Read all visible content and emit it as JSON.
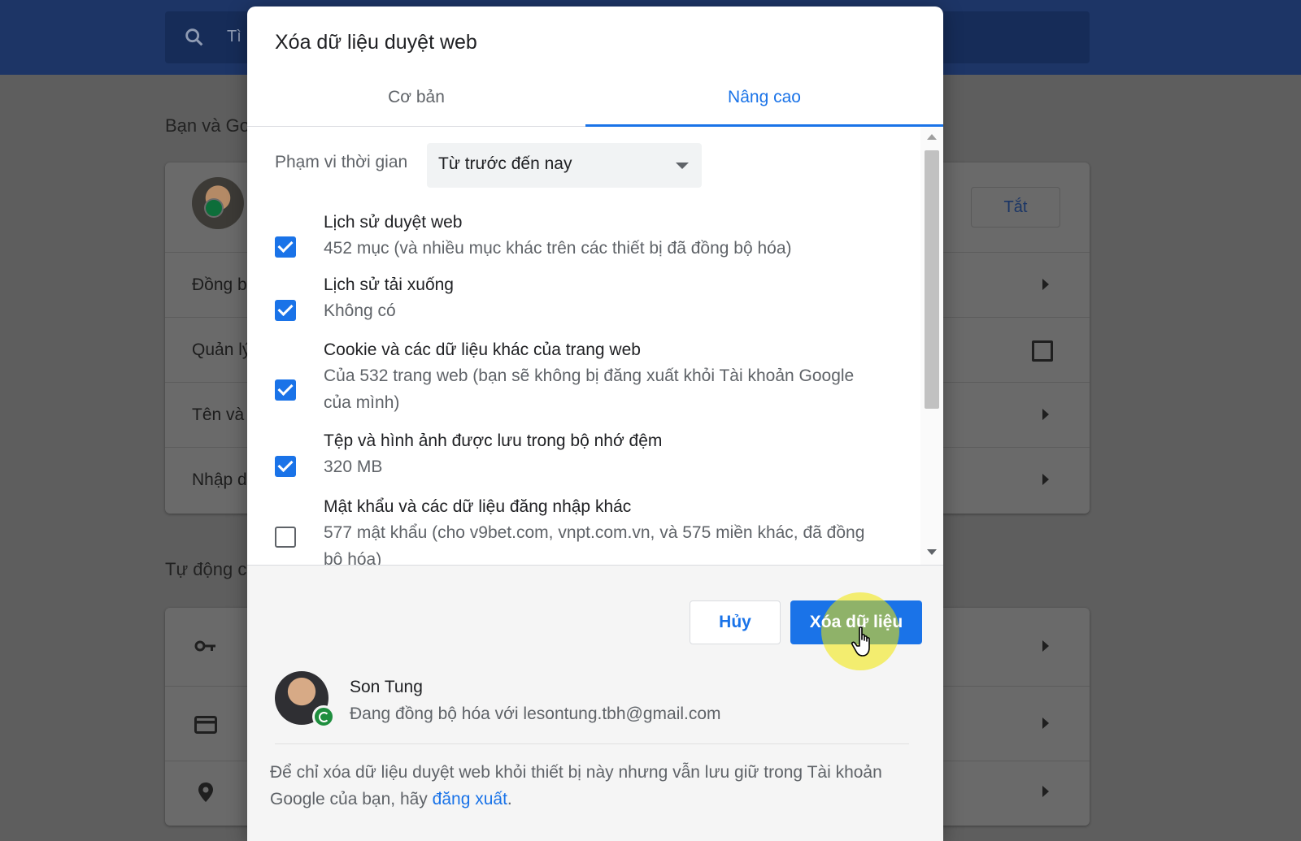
{
  "background": {
    "search_placeholder": "Tì",
    "section_you_google": "Bạn và Go",
    "section_autofill": "Tự động c",
    "turn_off_button": "Tắt",
    "rows": [
      {
        "label": "Đồng b"
      },
      {
        "label": "Quản lý"
      },
      {
        "label": "Tên và"
      },
      {
        "label": "Nhập d"
      }
    ],
    "colors": {
      "header": "#1d3566",
      "overlay": "#5e5e5e"
    }
  },
  "dialog": {
    "title": "Xóa dữ liệu duyệt web",
    "tabs": [
      {
        "label": "Cơ bản",
        "active": false
      },
      {
        "label": "Nâng cao",
        "active": true
      }
    ],
    "time_range": {
      "label": "Phạm vi thời gian",
      "value": "Từ trước đến nay"
    },
    "items": [
      {
        "title": "Lịch sử duyệt web",
        "desc": "452 mục (và nhiều mục khác trên các thiết bị đã đồng bộ hóa)",
        "checked": true
      },
      {
        "title": "Lịch sử tải xuống",
        "desc": "Không có",
        "checked": true
      },
      {
        "title": "Cookie và các dữ liệu khác của trang web",
        "desc": "Của 532 trang web (bạn sẽ không bị đăng xuất khỏi Tài khoản Google của mình)",
        "checked": true
      },
      {
        "title": "Tệp và hình ảnh được lưu trong bộ nhớ đệm",
        "desc": "320 MB",
        "checked": true
      },
      {
        "title": "Mật khẩu và các dữ liệu đăng nhập khác",
        "desc": "577 mật khẩu (cho v9bet.com, vnpt.com.vn, và 575 miền khác, đã đồng bộ hóa)",
        "checked": false
      }
    ],
    "buttons": {
      "cancel": "Hủy",
      "clear": "Xóa dữ liệu"
    },
    "account": {
      "name": "Son Tung",
      "sync_status": "Đang đồng bộ hóa với lesontung.tbh@gmail.com"
    },
    "note": {
      "text": "Để chỉ xóa dữ liệu duyệt web khỏi thiết bị này nhưng vẫn lưu giữ trong Tài khoản Google của bạn, hãy ",
      "link": "đăng xuất",
      "end": "."
    },
    "colors": {
      "accent": "#1a73e8",
      "cursor_highlight": "#f1e600"
    }
  }
}
